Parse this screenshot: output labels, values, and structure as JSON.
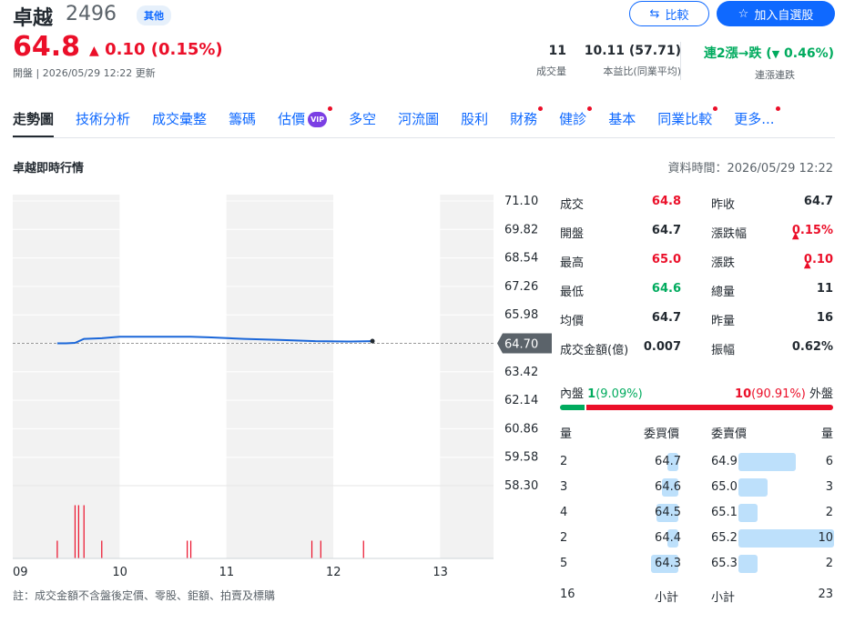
{
  "header": {
    "name": "卓越",
    "code": "2496",
    "category_tag": "其他",
    "compare_label": "比較",
    "watchlist_label": "加入自選股",
    "price": "64.8",
    "change": "0.10 (0.15%)",
    "updated": "開盤 | 2026/05/29 12:22 更新",
    "stats": [
      {
        "value": "11",
        "label": "成交量"
      },
      {
        "value": "10.11 (57.71)",
        "label": "本益比(同業平均)"
      },
      {
        "value_prefix": "連2漲→跌 (",
        "value_change": "0.46%)",
        "label": "連漲連跌"
      }
    ]
  },
  "tabs": [
    {
      "label": "走勢圖",
      "active": true,
      "dot": false
    },
    {
      "label": "技術分析",
      "dot": false
    },
    {
      "label": "成交彙整",
      "dot": false
    },
    {
      "label": "籌碼",
      "dot": false
    },
    {
      "label": "估價",
      "dot": true,
      "vip": "VIP"
    },
    {
      "label": "多空",
      "dot": false
    },
    {
      "label": "河流圖",
      "dot": false
    },
    {
      "label": "股利",
      "dot": false
    },
    {
      "label": "財務",
      "dot": true
    },
    {
      "label": "健診",
      "dot": true
    },
    {
      "label": "基本",
      "dot": false
    },
    {
      "label": "同業比較",
      "dot": true
    },
    {
      "label": "更多...",
      "dot": true
    }
  ],
  "section": {
    "title": "卓越即時行情",
    "data_time": "資料時間：2026/05/29 12:22"
  },
  "chart_data": {
    "type": "line",
    "x_ticks": [
      "09",
      "10",
      "11",
      "12",
      "13"
    ],
    "y_ticks": [
      "71.10",
      "69.82",
      "68.54",
      "67.26",
      "65.98",
      "64.70",
      "63.42",
      "62.14",
      "60.86",
      "59.58",
      "58.30"
    ],
    "ylim": [
      58.3,
      71.1
    ],
    "reference_price": 64.7,
    "reference_label": "64.70",
    "price_series": {
      "times": [
        "09:25",
        "09:30",
        "09:35",
        "09:40",
        "09:50",
        "10:00",
        "10:30",
        "10:40",
        "10:50",
        "11:10",
        "11:30",
        "11:50",
        "12:10",
        "12:22"
      ],
      "values": [
        64.7,
        64.7,
        64.72,
        64.9,
        64.93,
        65.0,
        65.0,
        65.0,
        64.97,
        64.9,
        64.85,
        64.8,
        64.78,
        64.8
      ]
    },
    "volume_series": {
      "times": [
        "09:25",
        "09:35",
        "09:37",
        "09:40",
        "09:50",
        "10:38",
        "10:40",
        "11:48",
        "11:53",
        "12:17"
      ],
      "values": [
        1,
        3,
        3,
        3,
        1,
        1,
        1,
        1,
        1,
        1
      ],
      "max": 4
    },
    "shaded_hours": [
      [
        "09:00",
        "10:00"
      ],
      [
        "11:00",
        "12:00"
      ],
      [
        "13:00",
        "13:30"
      ]
    ]
  },
  "quote": {
    "rows": [
      {
        "l": "成交",
        "v": "64.8",
        "vc": "red",
        "l2": "昨收",
        "v2": "64.7",
        "v2c": ""
      },
      {
        "l": "開盤",
        "v": "64.7",
        "vc": "",
        "l2": "漲跌幅",
        "v2": "0.15%",
        "v2c": "red",
        "up": true
      },
      {
        "l": "最高",
        "v": "65.0",
        "vc": "red",
        "l2": "漲跌",
        "v2": "0.10",
        "v2c": "red",
        "up": true
      },
      {
        "l": "最低",
        "v": "64.6",
        "vc": "green",
        "l2": "總量",
        "v2": "11",
        "v2c": ""
      },
      {
        "l": "均價",
        "v": "64.7",
        "vc": "",
        "l2": "昨量",
        "v2": "16",
        "v2c": ""
      },
      {
        "l": "成交金額(億)",
        "v": "0.007",
        "vc": "",
        "l2": "振幅",
        "v2": "0.62%",
        "v2c": ""
      }
    ],
    "inner_label": "內盤",
    "inner_value": "1",
    "inner_pct": "(9.09%)",
    "outer_value": "10",
    "outer_pct": "(90.91%)",
    "outer_label": "外盤",
    "inner_fraction": 0.0909
  },
  "orderbook": {
    "headers": {
      "qty": "量",
      "bid": "委買價",
      "ask": "委賣價",
      "qty2": "量"
    },
    "max_qty": 10,
    "rows": [
      {
        "bid_qty": "2",
        "bid": "64.7",
        "ask": "64.9",
        "ask_qty": "6"
      },
      {
        "bid_qty": "3",
        "bid": "64.6",
        "ask": "65.0",
        "ask_qty": "3"
      },
      {
        "bid_qty": "4",
        "bid": "64.5",
        "ask": "65.1",
        "ask_qty": "2"
      },
      {
        "bid_qty": "2",
        "bid": "64.4",
        "ask": "65.2",
        "ask_qty": "10"
      },
      {
        "bid_qty": "5",
        "bid": "64.3",
        "ask": "65.3",
        "ask_qty": "2"
      }
    ],
    "total_bid": "16",
    "total_label": "小計",
    "total_ask": "23"
  },
  "note": "註：成交金額不含盤後定價、零股、鉅額、拍賣及標購",
  "colors": {
    "up": "#eb0f29",
    "down": "#00ab5e",
    "accent": "#0f69ff",
    "line": "#1a66d8"
  }
}
